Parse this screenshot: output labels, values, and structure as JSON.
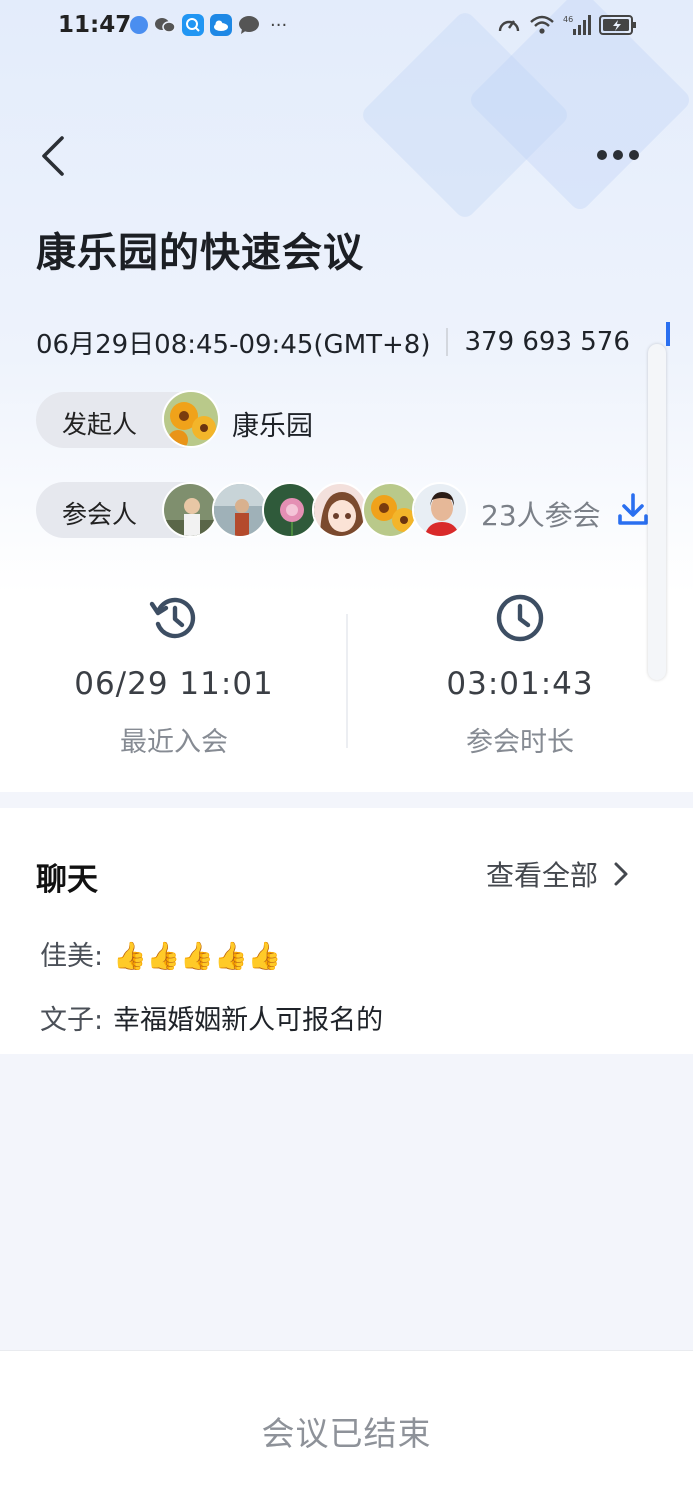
{
  "status_bar": {
    "time": "11:47"
  },
  "header": {
    "title": "康乐园的快速会议"
  },
  "meeting": {
    "time_range": "06月29日08:45-09:45(GMT+8)",
    "meeting_id": "379 693 576"
  },
  "initiator": {
    "label": "发起人",
    "name": "康乐园"
  },
  "participants": {
    "label": "参会人",
    "count_text": "23人参会",
    "avatars": [
      "participant-1",
      "participant-2",
      "participant-3",
      "participant-4",
      "participant-5",
      "participant-6"
    ]
  },
  "stats": {
    "last_join": {
      "value": "06/29 11:01",
      "label": "最近入会"
    },
    "duration": {
      "value": "03:01:43",
      "label": "参会时长"
    }
  },
  "chat": {
    "title": "聊天",
    "view_all": "查看全部",
    "messages": [
      {
        "sender": "佳美:",
        "text": "👍👍👍👍👍"
      },
      {
        "sender": "文子:",
        "text": "幸福婚姻新人可报名的"
      }
    ]
  },
  "footer": {
    "status": "会议已结束"
  },
  "colors": {
    "accent": "#2a6ff0",
    "muted": "#868b93"
  }
}
